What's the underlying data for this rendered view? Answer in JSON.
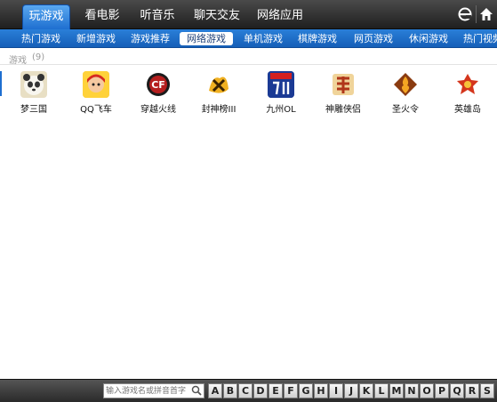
{
  "main_tabs": [
    {
      "label": "玩游戏",
      "active": true
    },
    {
      "label": "看电影",
      "active": false
    },
    {
      "label": "听音乐",
      "active": false
    },
    {
      "label": "聊天交友",
      "active": false
    },
    {
      "label": "网络应用",
      "active": false
    }
  ],
  "corner_buttons": [
    "ie-icon",
    "home-icon"
  ],
  "sub_tabs": [
    {
      "label": "热门游戏",
      "active": false
    },
    {
      "label": "新增游戏",
      "active": false
    },
    {
      "label": "游戏推荐",
      "active": false
    },
    {
      "label": "网络游戏",
      "active": true
    },
    {
      "label": "单机游戏",
      "active": false
    },
    {
      "label": "棋牌游戏",
      "active": false
    },
    {
      "label": "网页游戏",
      "active": false
    },
    {
      "label": "休闲游戏",
      "active": false
    },
    {
      "label": "热门视频",
      "active": false
    }
  ],
  "section": {
    "title": "游戏",
    "count": "(9)"
  },
  "games": [
    {
      "name": "梦三国",
      "icon": "panda-icon",
      "color": "#d9c89a"
    },
    {
      "name": "QQ飞车",
      "icon": "racer-icon",
      "color": "#f0b83a"
    },
    {
      "name": "穿越火线",
      "icon": "cf-logo-icon",
      "color": "#8a1b1b"
    },
    {
      "name": "封神榜III",
      "icon": "fengshen-icon",
      "color": "#e9a21e"
    },
    {
      "name": "九州OL",
      "icon": "jiuzhou-icon",
      "color": "#1a3f9a"
    },
    {
      "name": "神雕侠侣",
      "icon": "shendiao-icon",
      "color": "#c2551f"
    },
    {
      "name": "圣火令",
      "icon": "shenghuo-icon",
      "color": "#b4621a"
    },
    {
      "name": "英雄岛",
      "icon": "hero-island-icon",
      "color": "#c23a1a"
    }
  ],
  "search": {
    "placeholder": "输入游戏名或拼音首字"
  },
  "letters": [
    "A",
    "B",
    "C",
    "D",
    "E",
    "F",
    "G",
    "H",
    "I",
    "J",
    "K",
    "L",
    "M",
    "N",
    "O",
    "P",
    "Q",
    "R",
    "S"
  ],
  "colors": {
    "accent": "#1e6fd0",
    "topbar": "#2a2a2a"
  }
}
